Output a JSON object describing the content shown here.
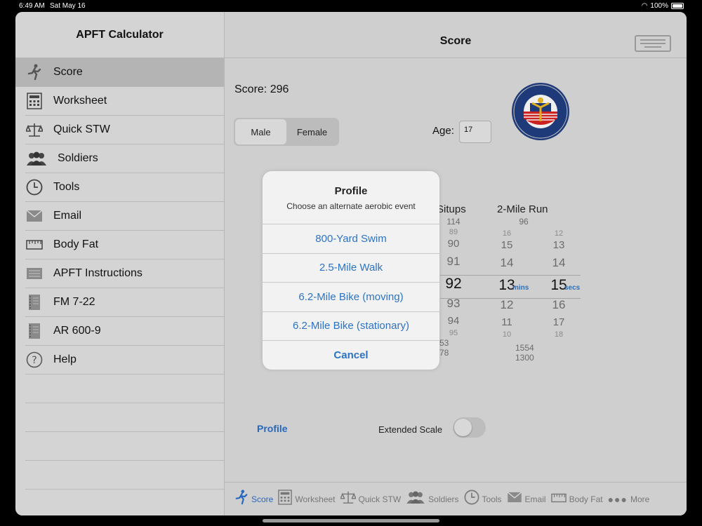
{
  "status": {
    "time": "6:49 AM",
    "date": "Sat May 16",
    "battery": "100%"
  },
  "sidebar": {
    "title": "APFT Calculator",
    "items": [
      {
        "label": "Score",
        "icon": "runner-icon"
      },
      {
        "label": "Worksheet",
        "icon": "calculator-icon"
      },
      {
        "label": "Quick STW",
        "icon": "scale-icon"
      },
      {
        "label": "Soldiers",
        "icon": "people-icon"
      },
      {
        "label": "Tools",
        "icon": "clock-icon"
      },
      {
        "label": "Email",
        "icon": "envelope-icon"
      },
      {
        "label": "Body Fat",
        "icon": "tape-measure-icon"
      },
      {
        "label": "APFT Instructions",
        "icon": "document-icon"
      },
      {
        "label": "FM 7-22",
        "icon": "notebook-icon"
      },
      {
        "label": "AR 600-9",
        "icon": "notebook-icon"
      },
      {
        "label": "Help",
        "icon": "question-icon"
      }
    ]
  },
  "main": {
    "title": "Score",
    "score": "Score: 296",
    "gender": {
      "male": "Male",
      "female": "Female",
      "selected": "Male"
    },
    "age_label": "Age:",
    "age_value": "17",
    "columns": {
      "situps": "Situps",
      "run": "2-Mile Run"
    },
    "situps_picker": {
      "above_top": "114",
      "above": [
        "89",
        "90",
        "91"
      ],
      "selected": "92",
      "below": [
        "93",
        "94",
        "95"
      ],
      "extra": [
        "53",
        "78"
      ]
    },
    "run_top": "96",
    "mins_picker": {
      "above": [
        "16",
        "15",
        "14"
      ],
      "selected": "13",
      "below": [
        "12",
        "11",
        "10"
      ],
      "unit": "mins"
    },
    "secs_picker": {
      "above": [
        "12",
        "13",
        "14"
      ],
      "selected": "15",
      "below": [
        "16",
        "17",
        "18"
      ],
      "unit": "secs"
    },
    "run_extra": [
      "1554",
      "1300"
    ],
    "profile_link": "Profile",
    "extended_scale": "Extended Scale"
  },
  "tabs": [
    {
      "label": "Score",
      "icon": "runner-icon"
    },
    {
      "label": "Worksheet",
      "icon": "calculator-icon"
    },
    {
      "label": "Quick STW",
      "icon": "scale-icon"
    },
    {
      "label": "Soldiers",
      "icon": "people-icon"
    },
    {
      "label": "Tools",
      "icon": "clock-icon"
    },
    {
      "label": "Email",
      "icon": "envelope-icon"
    },
    {
      "label": "Body Fat",
      "icon": "tape-measure-icon"
    },
    {
      "label": "More",
      "icon": "more-dots-icon"
    }
  ],
  "sheet": {
    "title": "Profile",
    "message": "Choose an alternate aerobic event",
    "options": [
      "800-Yard Swim",
      "2.5-Mile Walk",
      "6.2-Mile Bike (moving)",
      "6.2-Mile Bike (stationary)"
    ],
    "cancel": "Cancel"
  },
  "colors": {
    "accent": "#2868c0",
    "background": "#cfcfcf",
    "sheet": "#f2f2f2"
  }
}
